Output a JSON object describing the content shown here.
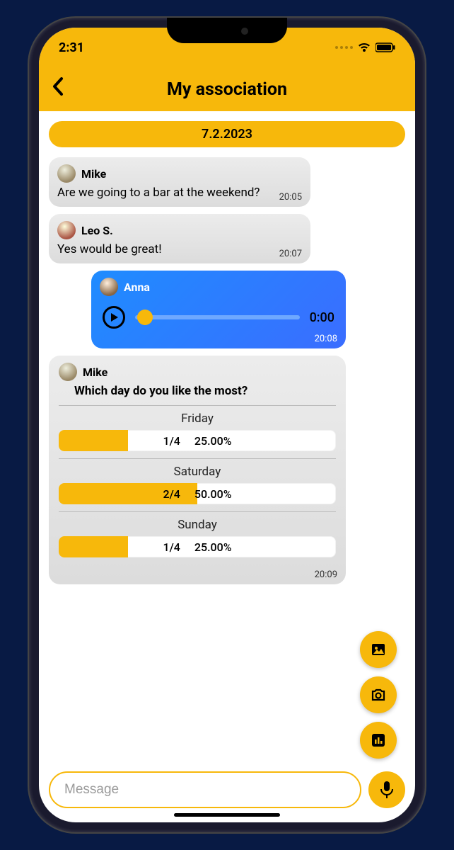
{
  "status": {
    "time": "2:31"
  },
  "header": {
    "title": "My association"
  },
  "chat": {
    "date": "7.2.2023",
    "messages": [
      {
        "sender": "Mike",
        "text": "Are we going to a bar at the weekend?",
        "time": "20:05"
      },
      {
        "sender": "Leo S.",
        "text": "Yes would be great!",
        "time": "20:07"
      },
      {
        "sender": "Anna",
        "audio_time": "0:00",
        "time": "20:08"
      },
      {
        "sender": "Mike",
        "question": "Which day do you like the most?",
        "time": "20:09",
        "options": [
          {
            "label": "Friday",
            "count": "1/4",
            "pct": "25.00%",
            "fill": 25
          },
          {
            "label": "Saturday",
            "count": "2/4",
            "pct": "50.00%",
            "fill": 50
          },
          {
            "label": "Sunday",
            "count": "1/4",
            "pct": "25.00%",
            "fill": 25
          }
        ]
      }
    ]
  },
  "input": {
    "placeholder": "Message"
  }
}
